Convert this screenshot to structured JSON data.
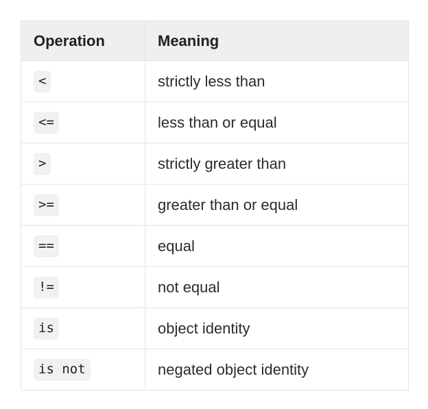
{
  "table": {
    "headers": [
      {
        "label": "Operation"
      },
      {
        "label": "Meaning"
      }
    ],
    "rows": [
      {
        "operation": "<",
        "meaning": "strictly less than"
      },
      {
        "operation": "<=",
        "meaning": "less than or equal"
      },
      {
        "operation": ">",
        "meaning": "strictly greater than"
      },
      {
        "operation": ">=",
        "meaning": "greater than or equal"
      },
      {
        "operation": "==",
        "meaning": "equal"
      },
      {
        "operation": "!=",
        "meaning": "not equal"
      },
      {
        "operation": "is",
        "meaning": "object identity"
      },
      {
        "operation": "is not",
        "meaning": "negated object identity"
      }
    ]
  },
  "colors": {
    "page_background": "#ffffff",
    "header_background": "#efefef",
    "header_text": "#212121",
    "body_text": "#2b2b2b",
    "code_background": "#eff1f3",
    "code_text": "#1f1f1f",
    "border": "#e5e5e5"
  }
}
